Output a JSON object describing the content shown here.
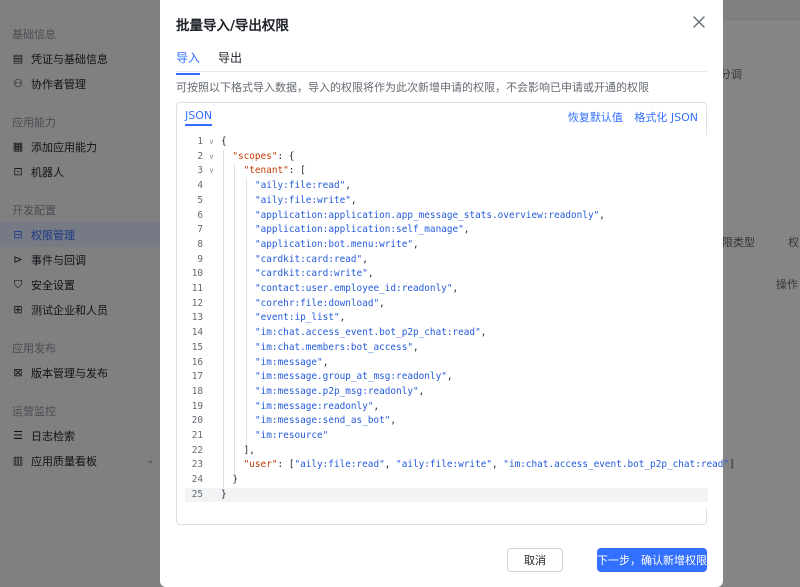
{
  "sidebar": {
    "sections": [
      {
        "title": "基础信息",
        "items": [
          {
            "label": "凭证与基础信息",
            "icon": "credential-icon"
          },
          {
            "label": "协作者管理",
            "icon": "people-icon"
          }
        ]
      },
      {
        "title": "应用能力",
        "items": [
          {
            "label": "添加应用能力",
            "icon": "apps-icon"
          },
          {
            "label": "机器人",
            "icon": "robot-icon"
          }
        ]
      },
      {
        "title": "开发配置",
        "items": [
          {
            "label": "权限管理",
            "icon": "key-icon",
            "active": true
          },
          {
            "label": "事件与回调",
            "icon": "event-icon"
          },
          {
            "label": "安全设置",
            "icon": "shield-icon"
          },
          {
            "label": "测试企业和人员",
            "icon": "test-icon"
          }
        ]
      },
      {
        "title": "应用发布",
        "items": [
          {
            "label": "版本管理与发布",
            "icon": "release-icon"
          }
        ]
      },
      {
        "title": "运营监控",
        "items": [
          {
            "label": "日志检索",
            "icon": "log-icon"
          },
          {
            "label": "应用质量看板",
            "icon": "dashboard-icon",
            "chevron": true
          }
        ]
      }
    ]
  },
  "background": {
    "frag1": "分调",
    "frag2": "限类型",
    "frag3": "权",
    "frag4": "操作"
  },
  "modal": {
    "title": "批量导入/导出权限",
    "tabs": [
      "导入",
      "导出"
    ],
    "description": "可按照以下格式导入数据，导入的权限将作为此次新增申请的权限，不会影响已申请或开通的权限",
    "editor": {
      "tab": "JSON",
      "restore": "恢复默认值",
      "format": "格式化 JSON"
    },
    "cancel": "取消",
    "confirm": "下一步，确认新增权限"
  },
  "code_lines": [
    {
      "n": "1",
      "fold": true,
      "indent": 0,
      "parts": [
        [
          "p",
          "{"
        ]
      ]
    },
    {
      "n": "2",
      "fold": true,
      "indent": 1,
      "parts": [
        [
          "k",
          "\"scopes\""
        ],
        [
          "p",
          ": {"
        ]
      ]
    },
    {
      "n": "3",
      "fold": true,
      "indent": 2,
      "parts": [
        [
          "k",
          "\"tenant\""
        ],
        [
          "p",
          ": ["
        ]
      ]
    },
    {
      "n": "4",
      "indent": 3,
      "parts": [
        [
          "s",
          "\"aily:file:read\""
        ],
        [
          "p",
          ","
        ]
      ]
    },
    {
      "n": "5",
      "indent": 3,
      "parts": [
        [
          "s",
          "\"aily:file:write\""
        ],
        [
          "p",
          ","
        ]
      ]
    },
    {
      "n": "6",
      "indent": 3,
      "parts": [
        [
          "s",
          "\"application:application.app_message_stats.overview:readonly\""
        ],
        [
          "p",
          ","
        ]
      ]
    },
    {
      "n": "7",
      "indent": 3,
      "parts": [
        [
          "s",
          "\"application:application:self_manage\""
        ],
        [
          "p",
          ","
        ]
      ]
    },
    {
      "n": "8",
      "indent": 3,
      "parts": [
        [
          "s",
          "\"application:bot.menu:write\""
        ],
        [
          "p",
          ","
        ]
      ]
    },
    {
      "n": "9",
      "indent": 3,
      "parts": [
        [
          "s",
          "\"cardkit:card:read\""
        ],
        [
          "p",
          ","
        ]
      ]
    },
    {
      "n": "10",
      "indent": 3,
      "parts": [
        [
          "s",
          "\"cardkit:card:write\""
        ],
        [
          "p",
          ","
        ]
      ]
    },
    {
      "n": "11",
      "indent": 3,
      "parts": [
        [
          "s",
          "\"contact:user.employee_id:readonly\""
        ],
        [
          "p",
          ","
        ]
      ]
    },
    {
      "n": "12",
      "indent": 3,
      "parts": [
        [
          "s",
          "\"corehr:file:download\""
        ],
        [
          "p",
          ","
        ]
      ]
    },
    {
      "n": "13",
      "indent": 3,
      "parts": [
        [
          "s",
          "\"event:ip_list\""
        ],
        [
          "p",
          ","
        ]
      ]
    },
    {
      "n": "14",
      "indent": 3,
      "parts": [
        [
          "s",
          "\"im:chat.access_event.bot_p2p_chat:read\""
        ],
        [
          "p",
          ","
        ]
      ]
    },
    {
      "n": "15",
      "indent": 3,
      "parts": [
        [
          "s",
          "\"im:chat.members:bot_access\""
        ],
        [
          "p",
          ","
        ]
      ]
    },
    {
      "n": "16",
      "indent": 3,
      "parts": [
        [
          "s",
          "\"im:message\""
        ],
        [
          "p",
          ","
        ]
      ]
    },
    {
      "n": "17",
      "indent": 3,
      "parts": [
        [
          "s",
          "\"im:message.group_at_msg:readonly\""
        ],
        [
          "p",
          ","
        ]
      ]
    },
    {
      "n": "18",
      "indent": 3,
      "parts": [
        [
          "s",
          "\"im:message.p2p_msg:readonly\""
        ],
        [
          "p",
          ","
        ]
      ]
    },
    {
      "n": "19",
      "indent": 3,
      "parts": [
        [
          "s",
          "\"im:message:readonly\""
        ],
        [
          "p",
          ","
        ]
      ]
    },
    {
      "n": "20",
      "indent": 3,
      "parts": [
        [
          "s",
          "\"im:message:send_as_bot\""
        ],
        [
          "p",
          ","
        ]
      ]
    },
    {
      "n": "21",
      "indent": 3,
      "parts": [
        [
          "s",
          "\"im:resource\""
        ]
      ]
    },
    {
      "n": "22",
      "indent": 2,
      "parts": [
        [
          "p",
          "],"
        ]
      ]
    },
    {
      "n": "23",
      "indent": 2,
      "parts": [
        [
          "k",
          "\"user\""
        ],
        [
          "p",
          ": ["
        ],
        [
          "s",
          "\"aily:file:read\""
        ],
        [
          "p",
          ", "
        ],
        [
          "s",
          "\"aily:file:write\""
        ],
        [
          "p",
          ", "
        ],
        [
          "s",
          "\"im:chat.access_event.bot_p2p_chat:read\""
        ],
        [
          "p",
          "]"
        ]
      ]
    },
    {
      "n": "24",
      "indent": 1,
      "parts": [
        [
          "p",
          "}"
        ]
      ]
    },
    {
      "n": "25",
      "indent": 0,
      "active": true,
      "parts": [
        [
          "p",
          "}"
        ]
      ]
    }
  ],
  "colors": {
    "accent": "#3370ff",
    "key": "#c43b04",
    "string": "#245bdb"
  }
}
